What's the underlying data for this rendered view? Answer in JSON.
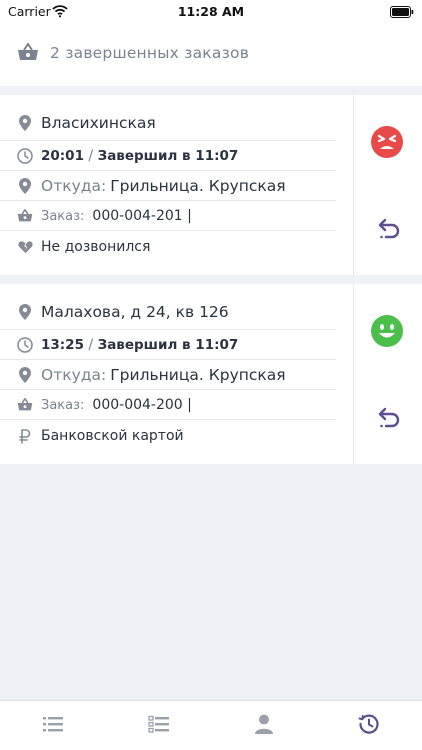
{
  "status_bar": {
    "carrier": "Carrier",
    "time": "11:28 AM"
  },
  "header": {
    "title": "2 завершенных заказов",
    "icon": "basket-icon"
  },
  "orders": [
    {
      "address": "Власихинская",
      "time": "20:01",
      "separator": " / ",
      "finished": "Завершил в 11:07",
      "from_label": "Откуда:",
      "from_value": "Грильница. Крупская",
      "order_label": "Заказ:",
      "order_value": "000-004-201 |",
      "note": "Не дозвонился",
      "note_icon": "broken-heart-icon",
      "mood": "angry-face-icon",
      "mood_color": "#e84a4a"
    },
    {
      "address": "Малахова, д 24, кв 126",
      "time": "13:25",
      "separator": " / ",
      "finished": "Завершил в 11:07",
      "from_label": "Откуда:",
      "from_value": "Грильница. Крупская",
      "order_label": "Заказ:",
      "order_value": "000-004-200 |",
      "note": "Банковской картой",
      "note_icon": "ruble-icon",
      "mood": "happy-face-icon",
      "mood_color": "#4cbe4c"
    }
  ],
  "colors": {
    "accent": "#5b4f8f",
    "icon_gray": "#848b97",
    "background": "#eef1f5"
  },
  "tabbar": {
    "tabs": [
      {
        "name": "list-icon",
        "active": false
      },
      {
        "name": "checklist-icon",
        "active": false
      },
      {
        "name": "user-icon",
        "active": false
      },
      {
        "name": "history-icon",
        "active": true
      }
    ]
  }
}
